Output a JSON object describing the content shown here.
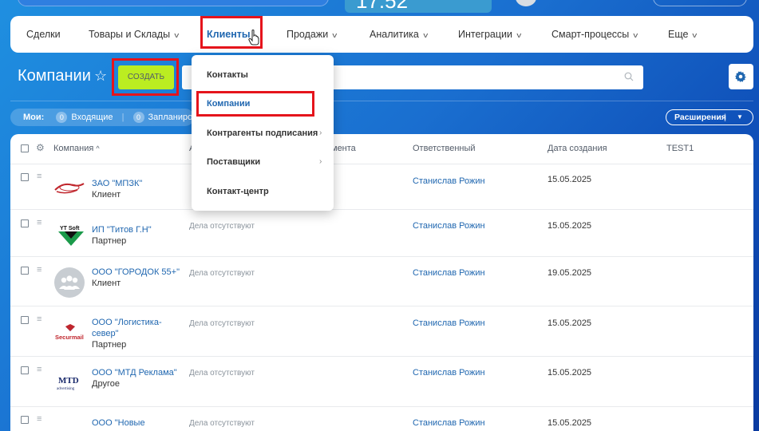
{
  "header": {
    "clock": "17:52"
  },
  "nav": {
    "items": [
      {
        "label": "Сделки"
      },
      {
        "label": "Товары и Склады"
      },
      {
        "label": "Клиенты"
      },
      {
        "label": "Продажи"
      },
      {
        "label": "Аналитика"
      },
      {
        "label": "Интеграции"
      },
      {
        "label": "Смарт-процессы"
      },
      {
        "label": "Еще"
      }
    ],
    "active_label": "Клиенты"
  },
  "page": {
    "title": "Компании",
    "create_label": "создать",
    "extensions_label": "Расширения"
  },
  "counters": {
    "label": "Мои:",
    "incoming_count": "0",
    "incoming_label": "Входящие",
    "planned_count": "0",
    "planned_label": "Запланиро"
  },
  "dropdown": {
    "items": [
      {
        "label": "Контакты"
      },
      {
        "label": "Компании"
      },
      {
        "label": "Контрагенты подписания"
      },
      {
        "label": "Поставщики"
      },
      {
        "label": "Контакт-центр"
      }
    ]
  },
  "table": {
    "columns": [
      "Компания",
      "А",
      "мента",
      "Ответственный",
      "Дата создания",
      "TEST1"
    ],
    "rows": [
      {
        "name": "ЗАО \"МПЗК\"",
        "type": "Клиент",
        "activity": "",
        "responsible": "Станислав Рожин",
        "date": "15.05.2025",
        "logo": "mpzk-logo"
      },
      {
        "name": "ИП \"Титов Г.Н\"",
        "type": "Партнер",
        "activity": "Дела отсутствуют",
        "responsible": "Станислав Рожин",
        "date": "15.05.2025",
        "logo": "ytsoft-logo",
        "logo_text": "YT Soft"
      },
      {
        "name": "ООО \"ГОРОДОК 55+\"",
        "type": "Клиент",
        "activity": "Дела отсутствуют",
        "responsible": "Станислав Рожин",
        "date": "19.05.2025",
        "logo": "company-placeholder-icon"
      },
      {
        "name": "ООО \"Логистика-север\"",
        "type": "Партнер",
        "activity": "Дела отсутствуют",
        "responsible": "Станислав Рожин",
        "date": "15.05.2025",
        "logo": "securmail-logo",
        "logo_text": "Securmail"
      },
      {
        "name": "ООО \"МТД Реклама\"",
        "type": "Другое",
        "activity": "Дела отсутствуют",
        "responsible": "Станислав Рожин",
        "date": "15.05.2025",
        "logo": "mtd-logo",
        "logo_text": "MTD",
        "logo_subtext": "advertising"
      },
      {
        "name": "ООО \"Новые",
        "type": "",
        "activity": "Дела отсутствуют",
        "responsible": "Станислав Рожин",
        "date": "15.05.2025",
        "logo": "none"
      }
    ]
  },
  "colors": {
    "accent": "#2067b0",
    "create_button": "#bbed21",
    "highlight": "#e5141c"
  }
}
